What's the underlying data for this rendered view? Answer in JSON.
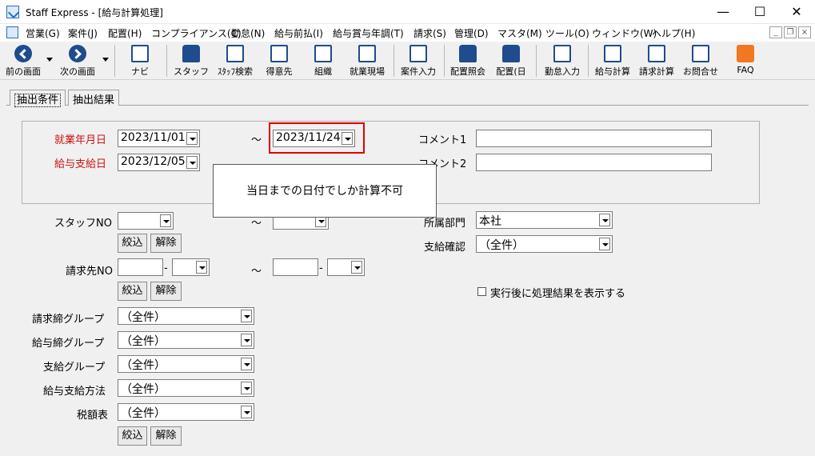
{
  "window": {
    "title": "Staff Express - [給与計算処理]",
    "minimize": "—",
    "maximize": "☐",
    "close": "✕"
  },
  "menu": [
    "営業(G)",
    "案件(J)",
    "配置(H)",
    "コンプライアンス(C)",
    "勤怠(N)",
    "給与前払(I)",
    "給与賞与年調(T)",
    "請求(S)",
    "管理(D)",
    "マスタ(M)",
    "ツール(O)",
    "ウィンドウ(W)",
    "ヘルプ(H)"
  ],
  "mdi": {
    "minimize": "_",
    "restore": "❐",
    "close": "×"
  },
  "toolbar": [
    {
      "label": "前の画面",
      "icon": "back-arrow-icon"
    },
    {
      "label": "次の画面",
      "icon": "forward-arrow-icon"
    },
    {
      "label": "ナビ",
      "icon": "keyboard-icon"
    },
    {
      "label": "スタッフ",
      "icon": "staff-icon"
    },
    {
      "label": "ｽﾀｯﾌ検索",
      "icon": "staff-search-icon"
    },
    {
      "label": "得意先",
      "icon": "client-building-icon"
    },
    {
      "label": "組織",
      "icon": "organization-icon"
    },
    {
      "label": "就業現場",
      "icon": "worksite-icon"
    },
    {
      "label": "案件入力",
      "icon": "case-entry-icon"
    },
    {
      "label": "配置照会",
      "icon": "placement-inquiry-icon"
    },
    {
      "label": "配置(日",
      "icon": "placement-daily-icon"
    },
    {
      "label": "勤怠入力",
      "icon": "attendance-entry-icon"
    },
    {
      "label": "給与計算",
      "icon": "payroll-calc-icon"
    },
    {
      "label": "請求計算",
      "icon": "billing-calc-icon"
    },
    {
      "label": "お問合せ",
      "icon": "inquiry-icon"
    },
    {
      "label": "FAQ",
      "icon": "faq-icon"
    }
  ],
  "tabs": {
    "conditions": "抽出条件",
    "results": "抽出結果"
  },
  "form": {
    "work_date_label": "就業年月日",
    "work_date_from": "2023/11/01",
    "tilde": "～",
    "work_date_to": "2023/11/24",
    "pay_date_label": "給与支給日",
    "pay_date": "2023/12/05",
    "comment1_label": "コメント1",
    "comment1": "",
    "comment2_label": "コメント2",
    "comment2": "",
    "staff_no_label": "スタッフNO",
    "staff_no_from": "",
    "staff_no_to": "",
    "dept_label": "所属部門",
    "dept_value": "本社",
    "pay_confirm_label": "支給確認",
    "pay_confirm_value": "（全件）",
    "narrow_label": "絞込",
    "clear_label": "解除",
    "client_no_label": "請求先NO",
    "dash": "-",
    "show_result_label": "実行後に処理結果を表示する",
    "billing_group_label": "請求締グループ",
    "billing_group_value": "（全件）",
    "pay_group_label": "給与締グループ",
    "pay_group_value": "（全件）",
    "payment_group_label": "支給グループ",
    "payment_group_value": "（全件）",
    "pay_method_label": "給与支給方法",
    "pay_method_value": "（全件）",
    "tax_table_label": "税額表",
    "tax_table_value": "（全件）"
  },
  "tooltip": "当日までの日付でしか計算不可",
  "colors": {
    "required_label": "#cc1111",
    "highlight": "#e00000",
    "icon_blue": "#1e4c8c",
    "faq_orange": "#f07820"
  }
}
